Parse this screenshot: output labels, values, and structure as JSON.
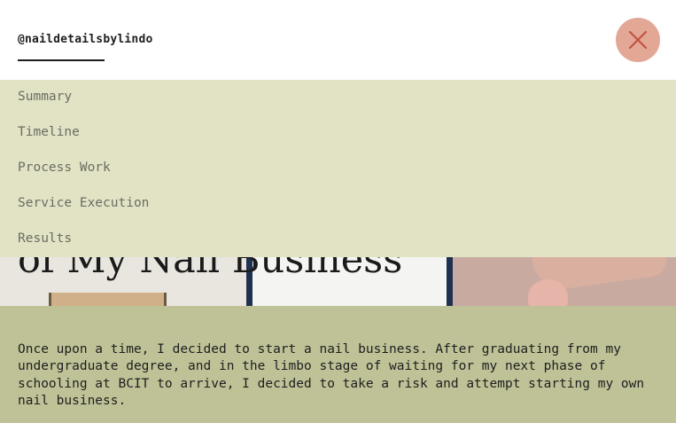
{
  "header": {
    "brand": "@naildetailsbylindo",
    "close_label": "Close menu"
  },
  "menu": {
    "items": [
      {
        "label": "Summary"
      },
      {
        "label": "Timeline"
      },
      {
        "label": "Process Work"
      },
      {
        "label": "Service Execution"
      },
      {
        "label": "Results"
      }
    ]
  },
  "hero": {
    "title_fragment": "of My Nail Business"
  },
  "intro": {
    "text": "Once upon a time, I decided to start a nail business. After graduating from my undergraduate degree, and in the limbo stage of waiting for my next phase of schooling at BCIT to arrive, I decided to take a risk and attempt starting my own nail business."
  },
  "colors": {
    "menu_bg": "#e1e3c4",
    "intro_bg": "#bfc297",
    "close_button_bg": "#e3a796",
    "close_icon": "#c0543f"
  },
  "icons": {
    "close": "close-icon"
  }
}
